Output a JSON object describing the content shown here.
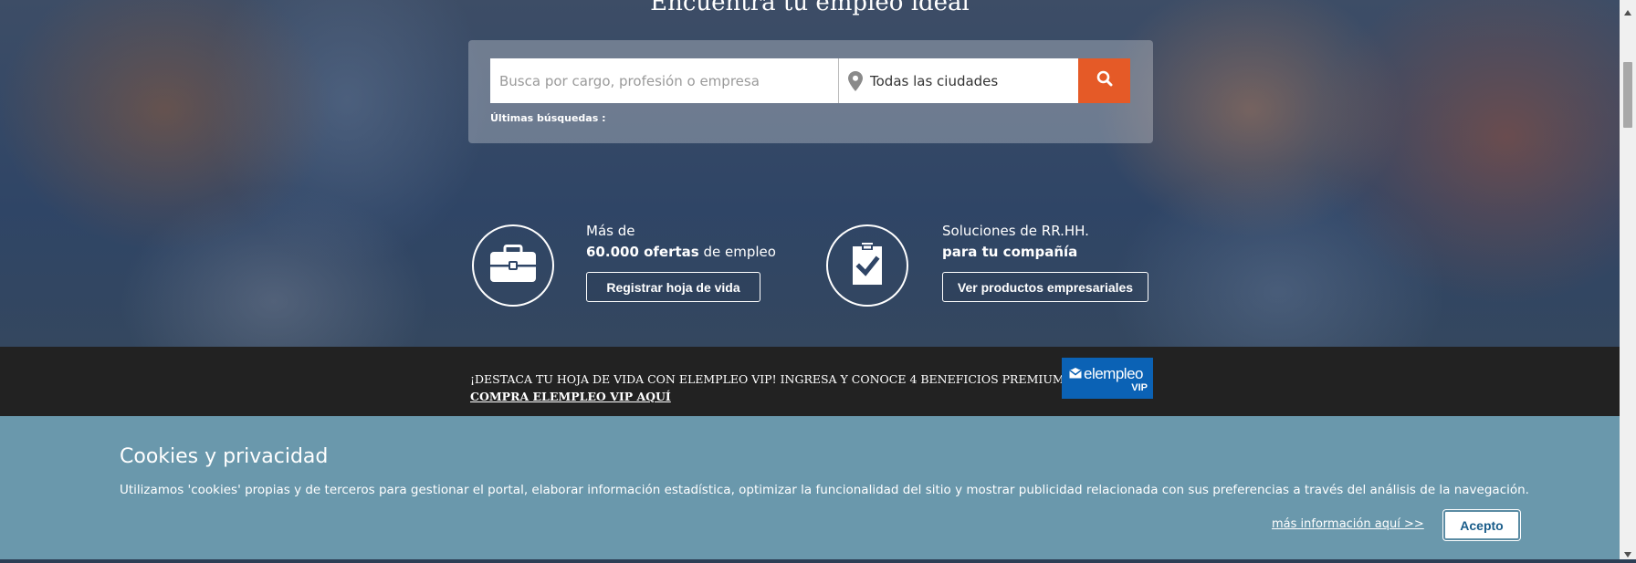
{
  "hero": {
    "title": "Encuentra tu empleo ideal"
  },
  "search": {
    "query_placeholder": "Busca por cargo, profesión o empresa",
    "query_value": "",
    "city_value": "Todas las ciudades",
    "recent_label": "Últimas búsquedas :"
  },
  "features": {
    "jobs": {
      "line1": "Más de",
      "count": "60.000 ofertas",
      "suffix": " de empleo",
      "button_label": "Registrar hoja de vida"
    },
    "companies": {
      "line1": "Soluciones de RR.HH.",
      "line2": "para tu compañía",
      "button_label": "Ver productos empresariales"
    }
  },
  "promo": {
    "text": "¡DESTACA TU HOJA DE VIDA CON ELEMPLEO VIP! INGRESA Y CONOCE 4 BENEFICIOS PREMIUM",
    "link": "COMPRA ELEMPLEO VIP AQUÍ",
    "badge_brand": "elempleo",
    "badge_sub": "VIP"
  },
  "cookies": {
    "title": "Cookies y privacidad",
    "body": "Utilizamos 'cookies' propias y de terceros para gestionar el portal, elaborar información estadística, optimizar la funcionalidad del sitio y mostrar publicidad relacionada con sus preferencias a través del análisis de la navegación.",
    "more_link": "más información aquí >>",
    "accept_label": "Acepto"
  },
  "colors": {
    "accent_orange": "#e55a27",
    "promo_bg": "#222222",
    "cookie_bg": "#6a98ac",
    "vip_blue": "#0b62b5"
  },
  "icons": [
    "map-pin-icon",
    "search-icon",
    "briefcase-icon",
    "clipboard-check-icon",
    "mail-icon",
    "scroll-up-arrow-icon",
    "scroll-down-arrow-icon"
  ]
}
